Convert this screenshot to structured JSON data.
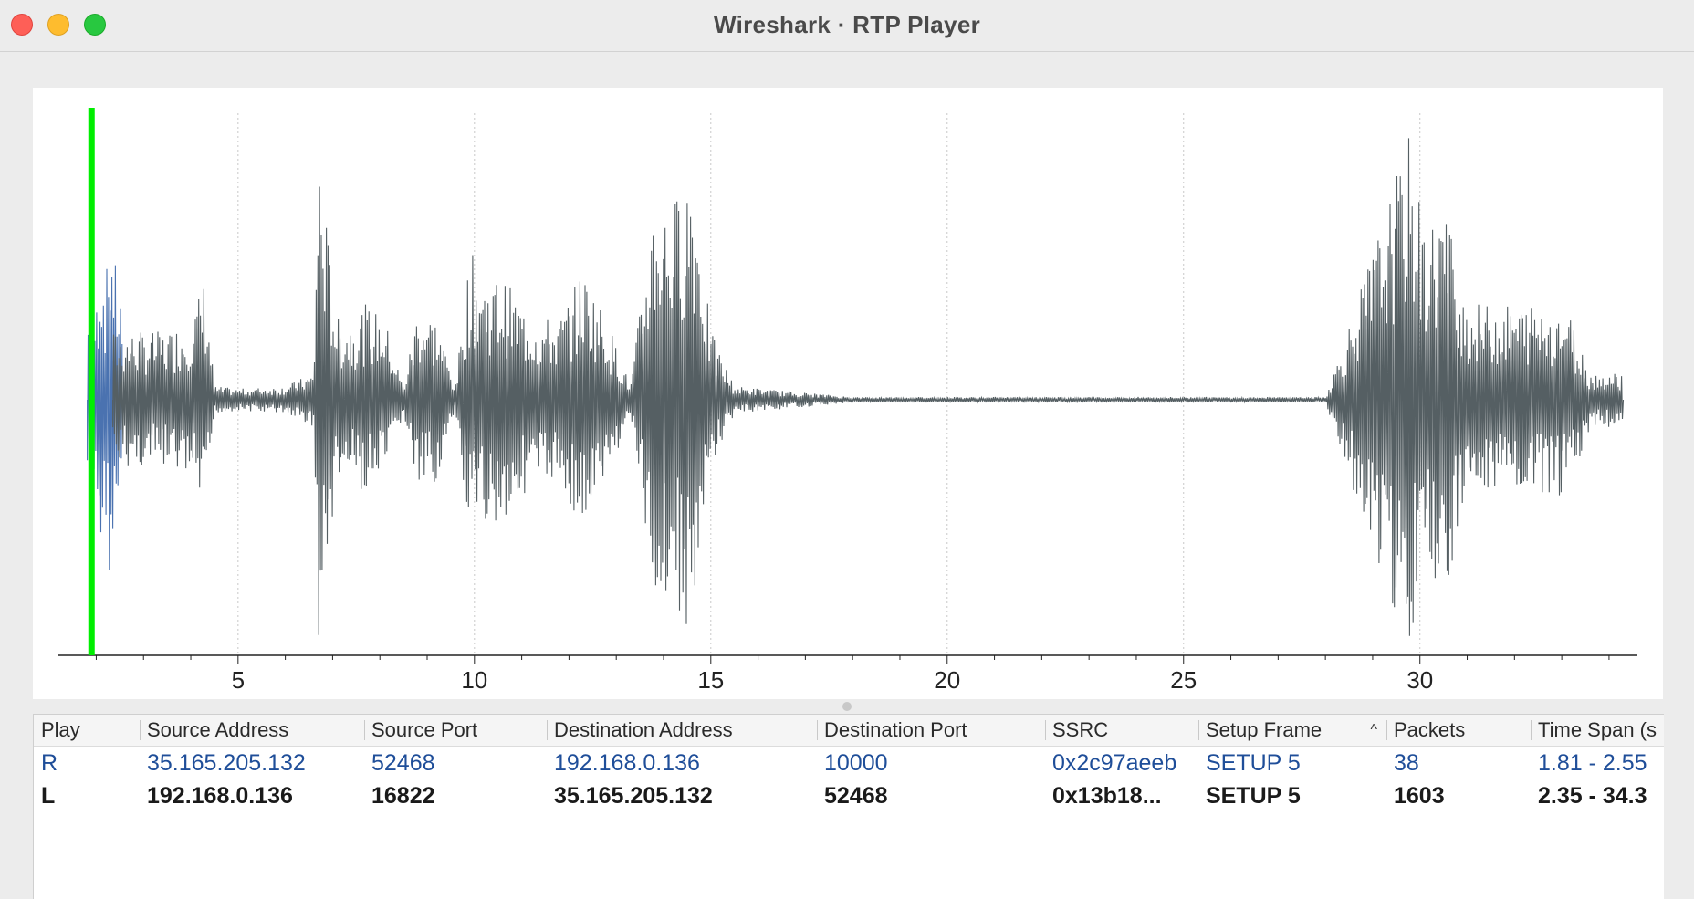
{
  "window": {
    "title": "Wireshark · RTP Player"
  },
  "colors": {
    "play_cursor": "#00ee00",
    "stream_r": "#4a72b0",
    "stream_l": "#555f63",
    "row_r_text": "#1f4e99"
  },
  "chart_data": {
    "type": "line",
    "title": "",
    "xlabel": "",
    "ylabel": "",
    "xlim": [
      1.2,
      34.6
    ],
    "ylim": [
      -1,
      1
    ],
    "x_ticks": [
      5,
      10,
      15,
      20,
      25,
      30
    ],
    "grid": true,
    "play_cursor_x": 1.9,
    "series": [
      {
        "name": "R",
        "x_range": [
          1.81,
          2.55
        ],
        "envelope": [
          [
            1.81,
            0.33
          ],
          [
            2.0,
            0.35
          ],
          [
            2.1,
            0.62
          ],
          [
            2.2,
            0.42
          ],
          [
            2.3,
            0.7
          ],
          [
            2.4,
            0.5
          ],
          [
            2.55,
            0.35
          ]
        ]
      },
      {
        "name": "L",
        "x_range": [
          2.35,
          34.3
        ],
        "envelope": [
          [
            3.5,
            0.25
          ],
          [
            4.0,
            0.3
          ],
          [
            4.3,
            0.45
          ],
          [
            4.5,
            0.05
          ],
          [
            5.0,
            0.04
          ],
          [
            6.0,
            0.05
          ],
          [
            6.6,
            0.1
          ],
          [
            6.7,
            0.98
          ],
          [
            6.9,
            0.6
          ],
          [
            7.1,
            0.3
          ],
          [
            7.4,
            0.3
          ],
          [
            7.7,
            0.35
          ],
          [
            8.1,
            0.3
          ],
          [
            8.5,
            0.05
          ],
          [
            8.8,
            0.35
          ],
          [
            9.2,
            0.3
          ],
          [
            9.6,
            0.05
          ],
          [
            9.9,
            0.55
          ],
          [
            10.2,
            0.45
          ],
          [
            10.6,
            0.45
          ],
          [
            11.0,
            0.35
          ],
          [
            11.4,
            0.3
          ],
          [
            11.8,
            0.3
          ],
          [
            12.3,
            0.48
          ],
          [
            12.8,
            0.3
          ],
          [
            13.3,
            0.05
          ],
          [
            13.8,
            0.75
          ],
          [
            14.2,
            0.72
          ],
          [
            14.6,
            0.9
          ],
          [
            15.0,
            0.25
          ],
          [
            15.5,
            0.05
          ],
          [
            18.0,
            0.01
          ],
          [
            22.5,
            0.01
          ],
          [
            23.5,
            0.01
          ],
          [
            28.0,
            0.01
          ],
          [
            29.8,
            0.98
          ],
          [
            30.1,
            0.6
          ],
          [
            30.5,
            0.75
          ],
          [
            31.0,
            0.35
          ],
          [
            31.5,
            0.35
          ],
          [
            32.2,
            0.35
          ],
          [
            32.6,
            0.35
          ],
          [
            33.1,
            0.35
          ],
          [
            33.6,
            0.1
          ]
        ]
      }
    ]
  },
  "table": {
    "columns": [
      "Play",
      "Source Address",
      "Source Port",
      "Destination Address",
      "Destination Port",
      "SSRC",
      "Setup Frame",
      "Packets",
      "Time Span (s"
    ],
    "sort_indicator": "^",
    "rows": [
      {
        "play": "R",
        "src_addr": "35.165.205.132",
        "src_port": "52468",
        "dst_addr": "192.168.0.136",
        "dst_port": "10000",
        "ssrc": "0x2c97aeeb",
        "setup": "SETUP 5",
        "packets": "38",
        "timespan": "1.81 - 2.55"
      },
      {
        "play": "L",
        "src_addr": "192.168.0.136",
        "src_port": "16822",
        "dst_addr": "35.165.205.132",
        "dst_port": "52468",
        "ssrc": "0x13b18...",
        "setup": "SETUP 5",
        "packets": "1603",
        "timespan": "2.35 - 34.3"
      }
    ]
  }
}
